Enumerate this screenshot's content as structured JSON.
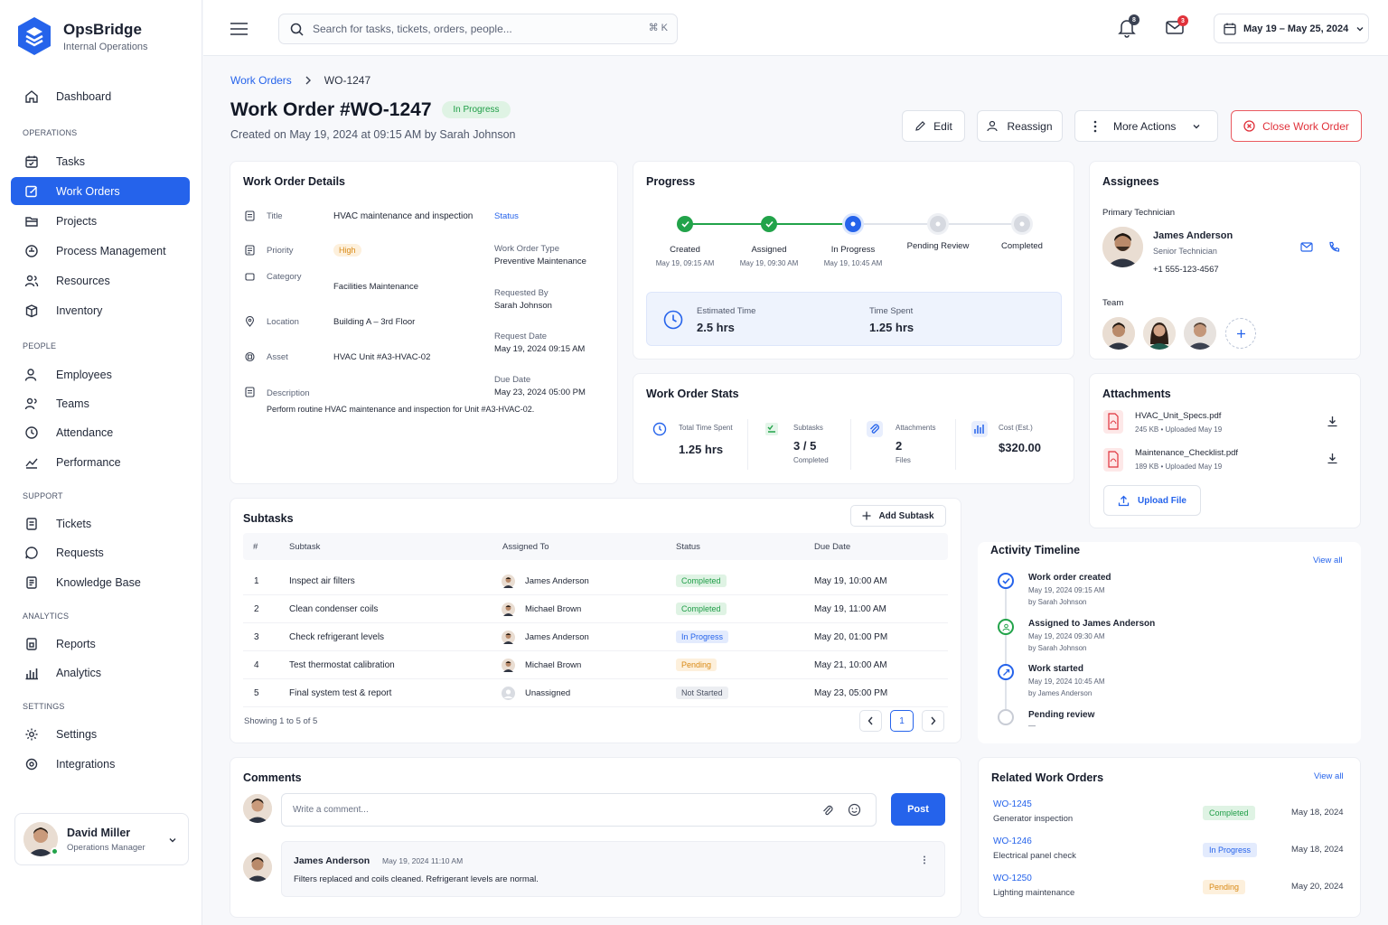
{
  "app": {
    "name": "OpsBridge",
    "subtitle": "Internal Operations"
  },
  "sidebar": {
    "dashboard": "Dashboard",
    "sections": [
      "OPERATIONS",
      "PEOPLE",
      "SUPPORT",
      "ANALYTICS",
      "SETTINGS"
    ],
    "items": [
      "Tasks",
      "Work Orders",
      "Projects",
      "Process Management",
      "Resources",
      "Inventory",
      "Employees",
      "Teams",
      "Attendance",
      "Performance",
      "Tickets",
      "Requests",
      "Knowledge Base",
      "Reports",
      "Analytics",
      "Settings",
      "Integrations"
    ],
    "user": {
      "name": "David Miller",
      "role": "Operations Manager"
    }
  },
  "topbar": {
    "search_placeholder": "Search for tasks, tickets, orders, people...",
    "shortcut": "⌘ K",
    "notifications_count": "8",
    "messages_count": "3",
    "date_range": "May 19 – May 25, 2024"
  },
  "breadcrumb": {
    "parent": "Work Orders",
    "current": "WO-1247"
  },
  "header": {
    "title": "Work Order #WO-1247",
    "status": "In Progress",
    "created": "Created on May 19, 2024 at 09:15 AM by Sarah Johnson",
    "buttons": {
      "edit": "Edit",
      "reassign": "Reassign",
      "more": "More Actions",
      "close": "Close Work Order"
    }
  },
  "details": {
    "title": "Work Order Details",
    "fields": {
      "title_label": "Title",
      "title_value": "HVAC maintenance and inspection",
      "status_label": "Status",
      "priority_label": "Priority",
      "priority_value": "High",
      "wo_type_label": "Work Order Type",
      "wo_type_value": "Preventive Maintenance",
      "category_label": "Category",
      "category_value": "Facilities Maintenance",
      "requested_by_label": "Requested By",
      "requested_by_value": "Sarah Johnson",
      "location_label": "Location",
      "location_value": "Building A – 3rd Floor",
      "request_date_label": "Request Date",
      "request_date_value": "May 19, 2024 09:15 AM",
      "asset_label": "Asset",
      "asset_value": "HVAC Unit #A3-HVAC-02",
      "due_date_label": "Due Date",
      "due_date_value": "May 23, 2024 05:00 PM",
      "description_label": "Description",
      "description_value": "Perform routine HVAC maintenance and inspection for Unit #A3-HVAC-02."
    }
  },
  "progress": {
    "title": "Progress",
    "steps": [
      {
        "label": "Created",
        "time": "May 19, 09:15 AM",
        "state": "done"
      },
      {
        "label": "Assigned",
        "time": "May 19, 09:30 AM",
        "state": "done"
      },
      {
        "label": "In Progress",
        "time": "May 19, 10:45 AM",
        "state": "current"
      },
      {
        "label": "Pending Review",
        "time": "",
        "state": "todo"
      },
      {
        "label": "Completed",
        "time": "",
        "state": "todo"
      }
    ],
    "estimated_label": "Estimated Time",
    "estimated_value": "2.5 hrs",
    "spent_label": "Time Spent",
    "spent_value": "1.25 hrs"
  },
  "stats": {
    "title": "Work Order Stats",
    "items": [
      {
        "label": "Total Time Spent",
        "value": "1.25 hrs",
        "sub": ""
      },
      {
        "label": "Subtasks",
        "value": "3 / 5",
        "sub": "Completed"
      },
      {
        "label": "Attachments",
        "value": "2",
        "sub": "Files"
      },
      {
        "label": "Cost (Est.)",
        "value": "$320.00",
        "sub": ""
      }
    ]
  },
  "assignees": {
    "title": "Assignees",
    "primary_label": "Primary Technician",
    "primary": {
      "name": "James Anderson",
      "role": "Senior Technician",
      "phone": "+1 555-123-4567"
    },
    "team_label": "Team"
  },
  "attachments": {
    "title": "Attachments",
    "files": [
      {
        "name": "HVAC_Unit_Specs.pdf",
        "meta": "245 KB • Uploaded May 19"
      },
      {
        "name": "Maintenance_Checklist.pdf",
        "meta": "189 KB • Uploaded May 19"
      }
    ],
    "upload": "Upload File"
  },
  "subtasks": {
    "title": "Subtasks",
    "add": "Add Subtask",
    "columns": [
      "#",
      "Subtask",
      "Assigned To",
      "Status",
      "Due Date"
    ],
    "rows": [
      {
        "n": "1",
        "name": "Inspect air filters",
        "assignee": "James Anderson",
        "status": "Completed",
        "due": "May 19, 10:00 AM"
      },
      {
        "n": "2",
        "name": "Clean condenser coils",
        "assignee": "Michael Brown",
        "status": "Completed",
        "due": "May 19, 11:00 AM"
      },
      {
        "n": "3",
        "name": "Check refrigerant levels",
        "assignee": "James Anderson",
        "status": "In Progress",
        "due": "May 20, 01:00 PM"
      },
      {
        "n": "4",
        "name": "Test thermostat calibration",
        "assignee": "Michael Brown",
        "status": "Pending",
        "due": "May 21, 10:00 AM"
      },
      {
        "n": "5",
        "name": "Final system test & report",
        "assignee": "Unassigned",
        "status": "Not Started",
        "due": "May 23, 05:00 PM"
      }
    ],
    "showing": "Showing 1 to 5 of 5",
    "page": "1"
  },
  "timeline": {
    "title": "Activity Timeline",
    "view_all": "View all",
    "events": [
      {
        "title": "Work order created",
        "time": "May 19, 2024 09:15 AM",
        "by": "by Sarah Johnson"
      },
      {
        "title": "Assigned to James Anderson",
        "time": "May 19, 2024 09:30 AM",
        "by": "by Sarah Johnson"
      },
      {
        "title": "Work started",
        "time": "May 19, 2024 10:45 AM",
        "by": "by James Anderson"
      },
      {
        "title": "Pending review",
        "time": "—",
        "by": ""
      }
    ]
  },
  "comments": {
    "title": "Comments",
    "placeholder": "Write a comment...",
    "post": "Post",
    "items": [
      {
        "author": "James Anderson",
        "time": "May 19, 2024 11:10 AM",
        "text": "Filters replaced and coils cleaned. Refrigerant levels are normal."
      }
    ]
  },
  "related": {
    "title": "Related Work Orders",
    "view_all": "View all",
    "items": [
      {
        "id": "WO-1245",
        "desc": "Generator inspection",
        "status": "Completed",
        "date": "May 18, 2024"
      },
      {
        "id": "WO-1246",
        "desc": "Electrical panel check",
        "status": "In Progress",
        "date": "May 18, 2024"
      },
      {
        "id": "WO-1250",
        "desc": "Lighting maintenance",
        "status": "Pending",
        "date": "May 20, 2024"
      }
    ]
  },
  "colors": {
    "accent": "#2563eb",
    "success": "#22a34a",
    "danger": "#e0323b",
    "warning": "#e38a17"
  }
}
